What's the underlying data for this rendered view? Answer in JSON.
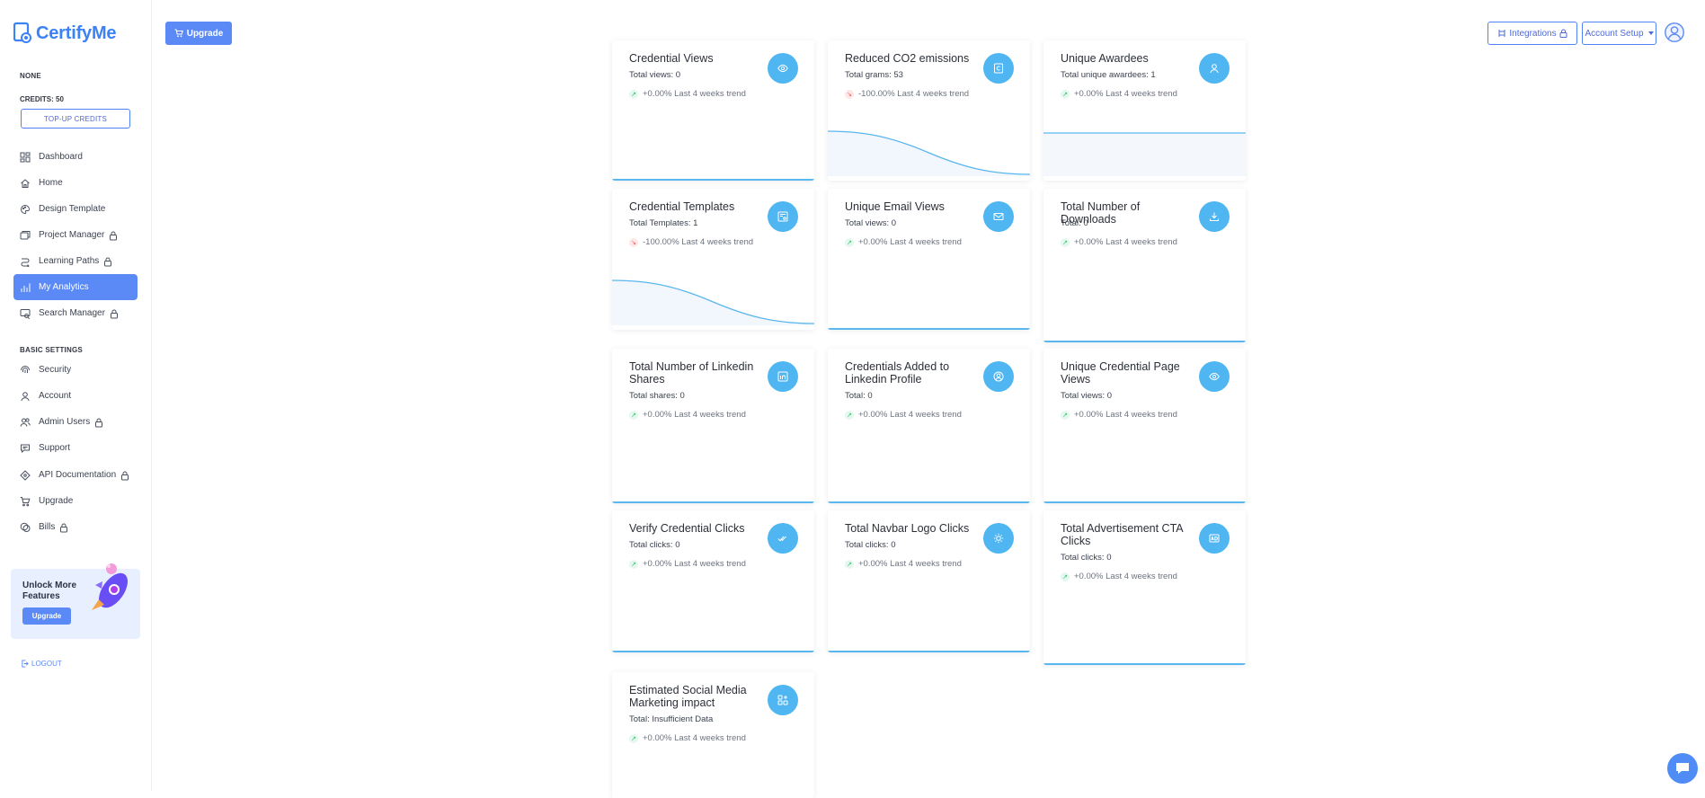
{
  "app": {
    "name": "CertifyMe"
  },
  "sidebar": {
    "plan": "NONE",
    "credits": "CREDITS: 50",
    "topup_label": "TOP-UP CREDITS",
    "items": [
      {
        "label": "Dashboard",
        "icon": "dashboard-icon",
        "locked": false,
        "active": false
      },
      {
        "label": "Home",
        "icon": "home-icon",
        "locked": false,
        "active": false
      },
      {
        "label": "Design Template",
        "icon": "palette-icon",
        "locked": false,
        "active": false
      },
      {
        "label": "Project Manager",
        "icon": "folders-icon",
        "locked": true,
        "active": false
      },
      {
        "label": "Learning Paths",
        "icon": "path-icon",
        "locked": true,
        "active": false
      },
      {
        "label": "My Analytics",
        "icon": "bar-chart-icon",
        "locked": false,
        "active": true
      },
      {
        "label": "Search Manager",
        "icon": "search-screen-icon",
        "locked": true,
        "active": false
      }
    ],
    "section_title": "BASIC SETTINGS",
    "settings_items": [
      {
        "label": "Security",
        "icon": "fingerprint-icon",
        "locked": false
      },
      {
        "label": "Account",
        "icon": "user-icon",
        "locked": false
      },
      {
        "label": "Admin Users",
        "icon": "users-icon",
        "locked": true
      },
      {
        "label": "Support",
        "icon": "chat-icon",
        "locked": false
      },
      {
        "label": "API Documentation",
        "icon": "api-icon",
        "locked": true
      },
      {
        "label": "Upgrade",
        "icon": "cart-icon",
        "locked": false
      },
      {
        "label": "Bills",
        "icon": "coins-icon",
        "locked": true
      }
    ],
    "promo": {
      "title": "Unlock More Features",
      "button": "Upgrade"
    },
    "logout": "LOGOUT"
  },
  "header": {
    "upgrade": "Upgrade",
    "integrations": "Integrations",
    "account_setup": "Account Setup"
  },
  "cards": [
    {
      "title": "Credential Views",
      "sub": "Total views: 0",
      "trend": "+0.00% Last 4 weeks trend",
      "dir": "up",
      "icon": "eye-icon"
    },
    {
      "title": "Reduced CO2 emissions",
      "sub": "Total grams: 53",
      "trend": "-100.00% Last 4 weeks trend",
      "dir": "down",
      "icon": "co2-icon"
    },
    {
      "title": "Unique Awardees",
      "sub": "Total unique awardees: 1",
      "trend": "+0.00% Last 4 weeks trend",
      "dir": "up",
      "icon": "user-icon"
    },
    {
      "title": "Credential Templates",
      "sub": "Total Templates: 1",
      "trend": "-100.00% Last 4 weeks trend",
      "dir": "down",
      "icon": "template-icon"
    },
    {
      "title": "Unique Email Views",
      "sub": "Total views: 0",
      "trend": "+0.00% Last 4 weeks trend",
      "dir": "up",
      "icon": "mail-icon"
    },
    {
      "title": "Total Number of Downloads",
      "sub": "Total: 0",
      "trend": "+0.00% Last 4 weeks trend",
      "dir": "up",
      "icon": "download-icon"
    },
    {
      "title": "Total Number of Linkedin Shares",
      "sub": "Total shares: 0",
      "trend": "+0.00% Last 4 weeks trend",
      "dir": "up",
      "icon": "linkedin-icon"
    },
    {
      "title": "Credentials Added to Linkedin Profile",
      "sub": "Total: 0",
      "trend": "+0.00% Last 4 weeks trend",
      "dir": "up",
      "icon": "profile-icon"
    },
    {
      "title": "Unique Credential Page Views",
      "sub": "Total views: 0",
      "trend": "+0.00% Last 4 weeks trend",
      "dir": "up",
      "icon": "eye-icon"
    },
    {
      "title": "Verify Credential Clicks",
      "sub": "Total clicks: 0",
      "trend": "+0.00% Last 4 weeks trend",
      "dir": "up",
      "icon": "double-check-icon"
    },
    {
      "title": "Total Navbar Logo Clicks",
      "sub": "Total clicks: 0",
      "trend": "+0.00% Last 4 weeks trend",
      "dir": "up",
      "icon": "sun-click-icon"
    },
    {
      "title": "Total Advertisement CTA Clicks",
      "sub": "Total clicks: 0",
      "trend": "+0.00% Last 4 weeks trend",
      "dir": "up",
      "icon": "ad-icon"
    },
    {
      "title": "Estimated Social Media Marketing impact",
      "sub": "Total: Insufficient Data",
      "trend": "+0.00% Last 4 weeks trend",
      "dir": "up",
      "icon": "apps-icon"
    }
  ]
}
